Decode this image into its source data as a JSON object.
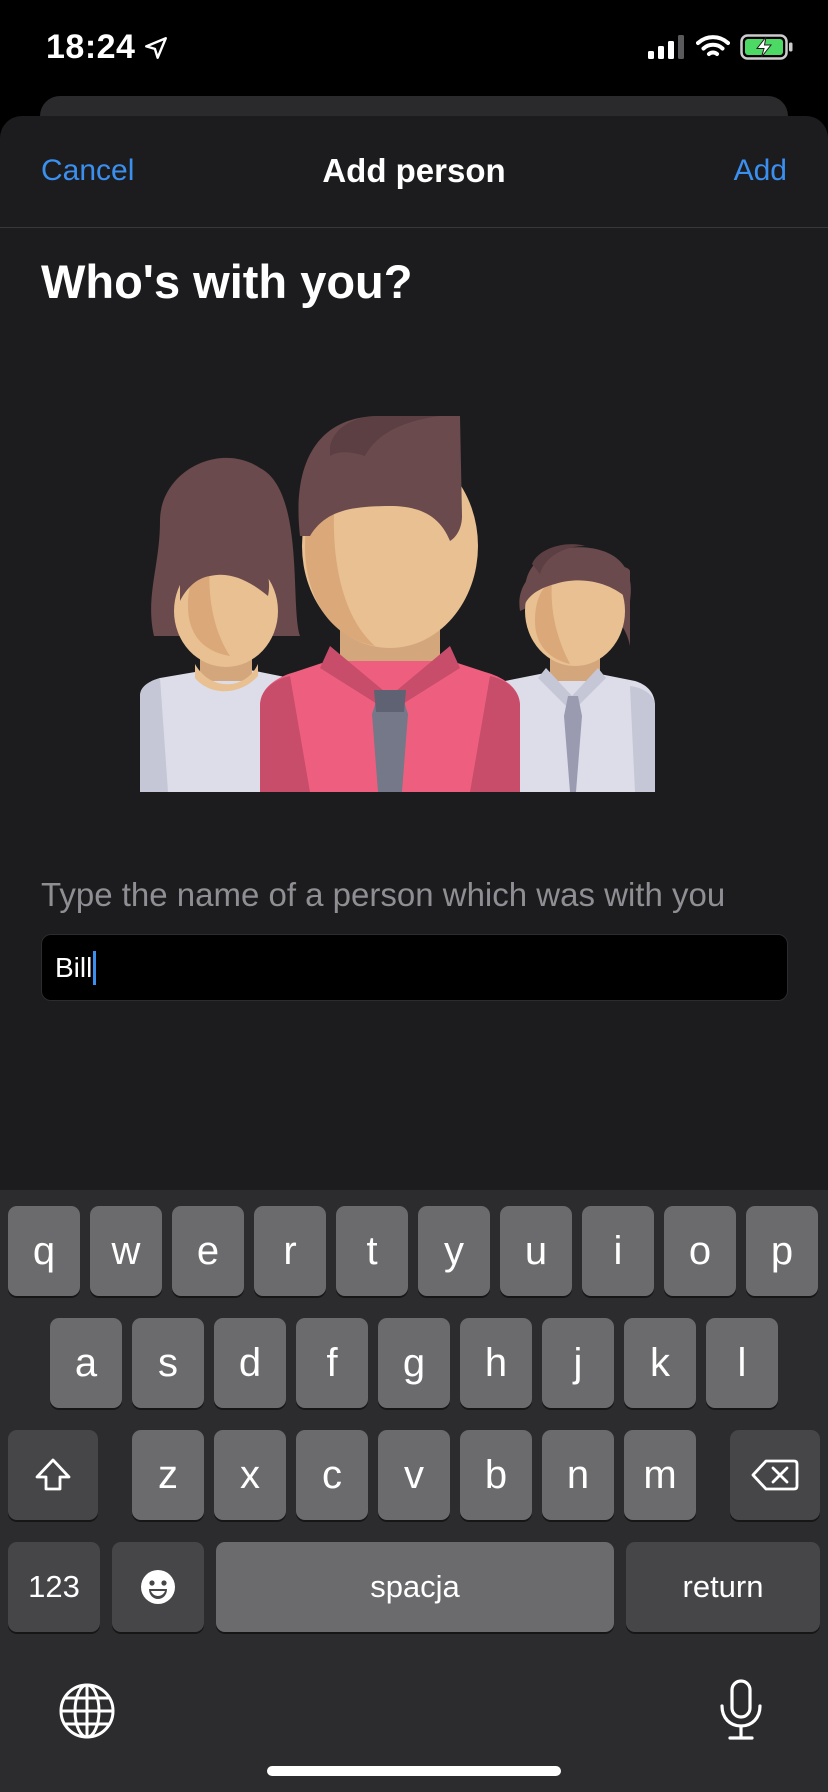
{
  "status_bar": {
    "time": "18:24"
  },
  "nav": {
    "cancel": "Cancel",
    "title": "Add person",
    "add": "Add"
  },
  "heading": "Who's with you?",
  "prompt": "Type the name of a person which was with you",
  "name_field": {
    "value": "Bill"
  },
  "colors": {
    "accent": "#3a8fef",
    "sheet_bg": "#1c1c1e",
    "key_bg": "#6b6b6d",
    "key_dark_bg": "#464648"
  },
  "keyboard": {
    "row1": [
      "q",
      "w",
      "e",
      "r",
      "t",
      "y",
      "u",
      "i",
      "o",
      "p"
    ],
    "row2": [
      "a",
      "s",
      "d",
      "f",
      "g",
      "h",
      "j",
      "k",
      "l"
    ],
    "row3": [
      "z",
      "x",
      "c",
      "v",
      "b",
      "n",
      "m"
    ],
    "numbers_key": "123",
    "space_key": "spacja",
    "return_key": "return",
    "icons": [
      "shift-icon",
      "delete-icon",
      "emoji-icon",
      "globe-icon",
      "microphone-icon"
    ]
  }
}
